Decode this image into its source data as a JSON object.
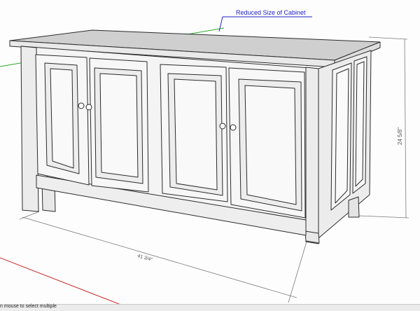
{
  "viewport": {
    "annotation": "Reduced Size of Cabinet",
    "dimension_height": "24 5/8\"",
    "dimension_width": "41 3/4\""
  },
  "status_bar": {
    "hint": "n mouse to select multiple"
  },
  "colors": {
    "background": "#fdfdfd",
    "edge": "#2b2b2b",
    "panel": "#f1f1f1",
    "top": "#cfcfcf",
    "annotation": "#2222cc",
    "axis_green": "#2aa82a",
    "axis_red": "#cc2a2a",
    "dimension_line": "#7a7a7a"
  }
}
